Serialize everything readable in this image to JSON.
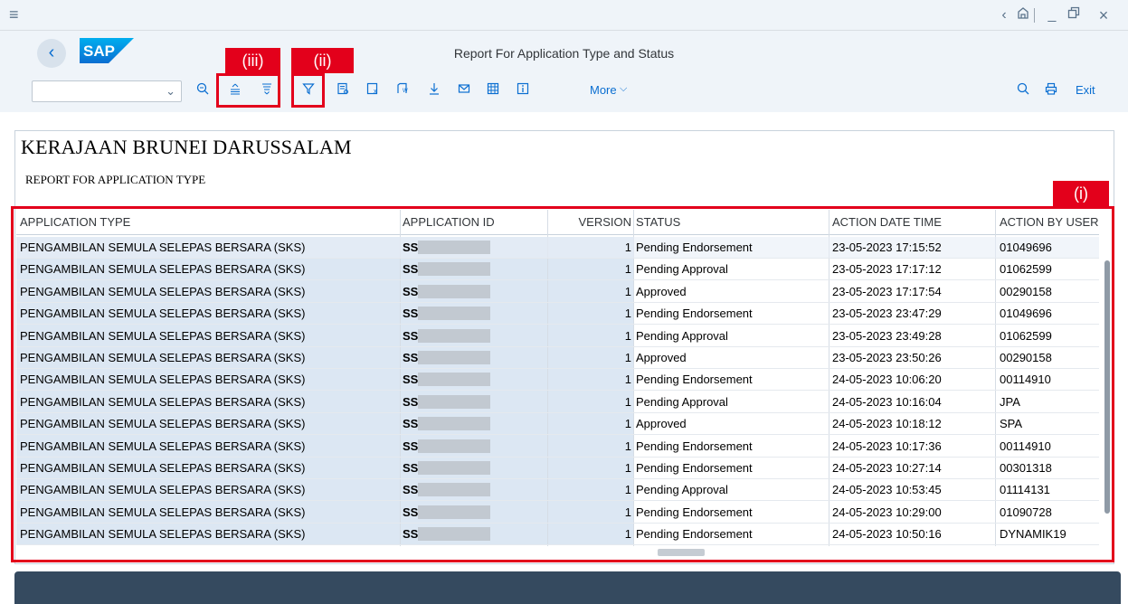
{
  "window": {
    "menu_icon": "hamburger-icon",
    "controls": [
      "<",
      "⌂",
      "_",
      "□",
      "×"
    ]
  },
  "header": {
    "title": "Report For Application Type and Status",
    "logo": "SAP"
  },
  "toolbar": {
    "variant_value": "",
    "more_label": "More",
    "exit_label": "Exit"
  },
  "annotations": {
    "label_i": "(i)",
    "label_ii": "(ii)",
    "label_iii": "(iii)",
    "color": "#e3001b"
  },
  "report": {
    "heading": "KERAJAAN BRUNEI DARUSSALAM",
    "subheading": "REPORT FOR APPLICATION TYPE",
    "columns": [
      "APPLICATION TYPE",
      "APPLICATION ID",
      "VERSION",
      "STATUS",
      "ACTION DATE TIME",
      "ACTION BY USER I"
    ],
    "rows": [
      {
        "type": "PENGAMBILAN SEMULA SELEPAS BERSARA (SKS)",
        "id": "SS",
        "version": "1",
        "status": "Pending Endorsement",
        "datetime": "23-05-2023 17:15:52",
        "user": "01049696"
      },
      {
        "type": "PENGAMBILAN SEMULA SELEPAS BERSARA (SKS)",
        "id": "SS",
        "version": "1",
        "status": "Pending Approval",
        "datetime": "23-05-2023 17:17:12",
        "user": "01062599"
      },
      {
        "type": "PENGAMBILAN SEMULA SELEPAS BERSARA (SKS)",
        "id": "SS",
        "version": "1",
        "status": "Approved",
        "datetime": "23-05-2023 17:17:54",
        "user": "00290158"
      },
      {
        "type": "PENGAMBILAN SEMULA SELEPAS BERSARA (SKS)",
        "id": "SS",
        "version": "1",
        "status": "Pending Endorsement",
        "datetime": "23-05-2023 23:47:29",
        "user": "01049696"
      },
      {
        "type": "PENGAMBILAN SEMULA SELEPAS BERSARA (SKS)",
        "id": "SS",
        "version": "1",
        "status": "Pending Approval",
        "datetime": "23-05-2023 23:49:28",
        "user": "01062599"
      },
      {
        "type": "PENGAMBILAN SEMULA SELEPAS BERSARA (SKS)",
        "id": "SS",
        "version": "1",
        "status": "Approved",
        "datetime": "23-05-2023 23:50:26",
        "user": "00290158"
      },
      {
        "type": "PENGAMBILAN SEMULA SELEPAS BERSARA (SKS)",
        "id": "SS",
        "version": "1",
        "status": "Pending Endorsement",
        "datetime": "24-05-2023 10:06:20",
        "user": "00114910"
      },
      {
        "type": "PENGAMBILAN SEMULA SELEPAS BERSARA (SKS)",
        "id": "SS",
        "version": "1",
        "status": "Pending Approval",
        "datetime": "24-05-2023 10:16:04",
        "user": "JPA"
      },
      {
        "type": "PENGAMBILAN SEMULA SELEPAS BERSARA (SKS)",
        "id": "SS",
        "version": "1",
        "status": "Approved",
        "datetime": "24-05-2023 10:18:12",
        "user": "SPA"
      },
      {
        "type": "PENGAMBILAN SEMULA SELEPAS BERSARA (SKS)",
        "id": "SS",
        "version": "1",
        "status": "Pending Endorsement",
        "datetime": "24-05-2023 10:17:36",
        "user": "00114910"
      },
      {
        "type": "PENGAMBILAN SEMULA SELEPAS BERSARA (SKS)",
        "id": "SS",
        "version": "1",
        "status": "Pending Endorsement",
        "datetime": "24-05-2023 10:27:14",
        "user": "00301318"
      },
      {
        "type": "PENGAMBILAN SEMULA SELEPAS BERSARA (SKS)",
        "id": "SS",
        "version": "1",
        "status": "Pending Approval",
        "datetime": "24-05-2023 10:53:45",
        "user": "01114131"
      },
      {
        "type": "PENGAMBILAN SEMULA SELEPAS BERSARA (SKS)",
        "id": "SS",
        "version": "1",
        "status": "Pending Endorsement",
        "datetime": "24-05-2023 10:29:00",
        "user": "01090728"
      },
      {
        "type": "PENGAMBILAN SEMULA SELEPAS BERSARA (SKS)",
        "id": "SS",
        "version": "1",
        "status": "Pending Endorsement",
        "datetime": "24-05-2023 10:50:16",
        "user": "DYNAMIK19"
      }
    ]
  }
}
